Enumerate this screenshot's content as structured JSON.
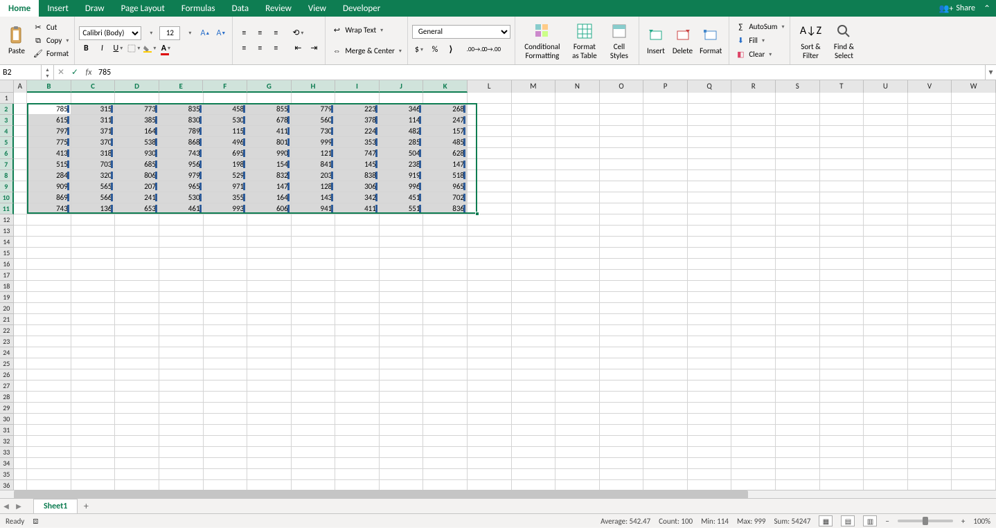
{
  "tabs": [
    "Home",
    "Insert",
    "Draw",
    "Page Layout",
    "Formulas",
    "Data",
    "Review",
    "View",
    "Developer"
  ],
  "active_tab": "Home",
  "share_label": "Share",
  "clipboard": {
    "paste": "Paste",
    "cut": "Cut",
    "copy": "Copy",
    "format": "Format"
  },
  "font": {
    "name": "Calibri (Body)",
    "size": "12"
  },
  "wrap_text": "Wrap Text",
  "merge_center": "Merge & Center",
  "number_format": "General",
  "cond_fmt": "Conditional Formatting",
  "fmt_table": "Format as Table",
  "cell_styles": "Cell Styles",
  "cells": {
    "insert": "Insert",
    "delete": "Delete",
    "format": "Format"
  },
  "editing": {
    "autosum": "AutoSum",
    "fill": "Fill",
    "clear": "Clear",
    "sort": "Sort & Filter",
    "find": "Find & Select"
  },
  "name_box": "B2",
  "formula": "785",
  "columns": [
    "A",
    "B",
    "C",
    "D",
    "E",
    "F",
    "G",
    "H",
    "I",
    "J",
    "K",
    "L",
    "M",
    "N",
    "O",
    "P",
    "Q",
    "R",
    "S",
    "T",
    "U",
    "V",
    "W"
  ],
  "selected_cols": [
    "B",
    "C",
    "D",
    "E",
    "F",
    "G",
    "H",
    "I",
    "J",
    "K"
  ],
  "selected_rows": [
    2,
    3,
    4,
    5,
    6,
    7,
    8,
    9,
    10,
    11
  ],
  "row_count": 36,
  "data": [
    [
      785,
      315,
      773,
      835,
      458,
      855,
      779,
      223,
      346,
      268
    ],
    [
      615,
      311,
      385,
      830,
      530,
      678,
      560,
      378,
      114,
      247
    ],
    [
      797,
      371,
      164,
      789,
      115,
      411,
      730,
      224,
      482,
      157
    ],
    [
      775,
      370,
      538,
      868,
      496,
      801,
      999,
      353,
      285,
      485
    ],
    [
      413,
      318,
      930,
      743,
      695,
      990,
      121,
      747,
      504,
      628
    ],
    [
      515,
      703,
      685,
      956,
      198,
      154,
      841,
      145,
      238,
      147
    ],
    [
      284,
      320,
      806,
      979,
      529,
      832,
      203,
      838,
      919,
      518
    ],
    [
      909,
      565,
      207,
      965,
      971,
      147,
      128,
      306,
      996,
      965
    ],
    [
      869,
      566,
      241,
      530,
      355,
      164,
      143,
      342,
      451,
      702
    ],
    [
      743,
      136,
      653,
      461,
      993,
      606,
      941,
      411,
      551,
      836
    ]
  ],
  "sheet_name": "Sheet1",
  "status": {
    "ready": "Ready",
    "average": "Average: 542.47",
    "count": "Count: 100",
    "min": "Min: 114",
    "max": "Max: 999",
    "sum": "Sum: 54247",
    "zoom": "100%"
  }
}
